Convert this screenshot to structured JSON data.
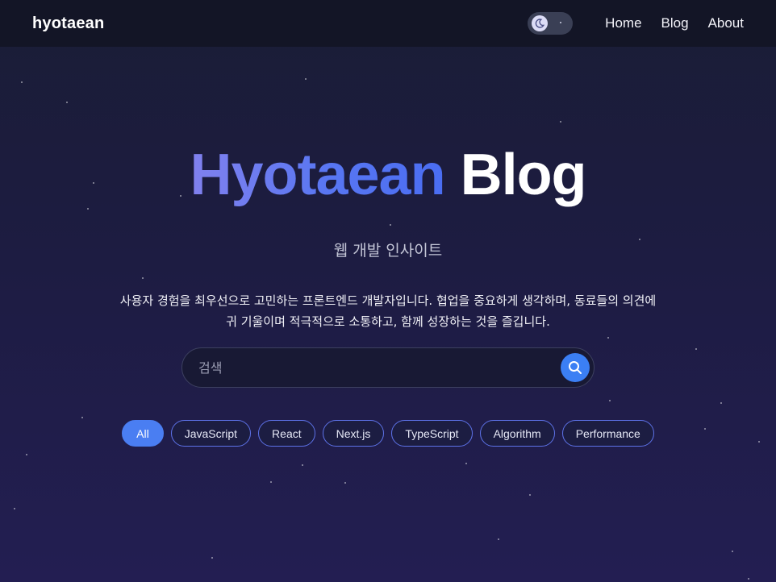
{
  "header": {
    "brand": "hyotaean",
    "nav": [
      {
        "label": "Home"
      },
      {
        "label": "Blog"
      },
      {
        "label": "About"
      }
    ],
    "theme_toggle": {
      "mode": "dark",
      "icon": "moon-icon"
    }
  },
  "hero": {
    "title_accent": "Hyotaean",
    "title_plain": "Blog",
    "subtitle": "웹 개발 인사이트",
    "intro": "사용자 경험을 최우선으로 고민하는 프론트엔드 개발자입니다. 협업을 중요하게 생각하며, 동료들의 의견에 귀 기울이며 적극적으로 소통하고, 함께 성장하는 것을 즐깁니다."
  },
  "search": {
    "placeholder": "검색",
    "value": "",
    "icon": "search-icon"
  },
  "tags": [
    {
      "label": "All",
      "active": true
    },
    {
      "label": "JavaScript",
      "active": false
    },
    {
      "label": "React",
      "active": false
    },
    {
      "label": "Next.js",
      "active": false
    },
    {
      "label": "TypeScript",
      "active": false
    },
    {
      "label": "Algorithm",
      "active": false
    },
    {
      "label": "Performance",
      "active": false
    }
  ],
  "colors": {
    "background_top": "#1a1d36",
    "background_bottom": "#231e52",
    "accent": "#4a7ef2",
    "title_gradient": [
      "#8181ee",
      "#4a6df2"
    ]
  }
}
